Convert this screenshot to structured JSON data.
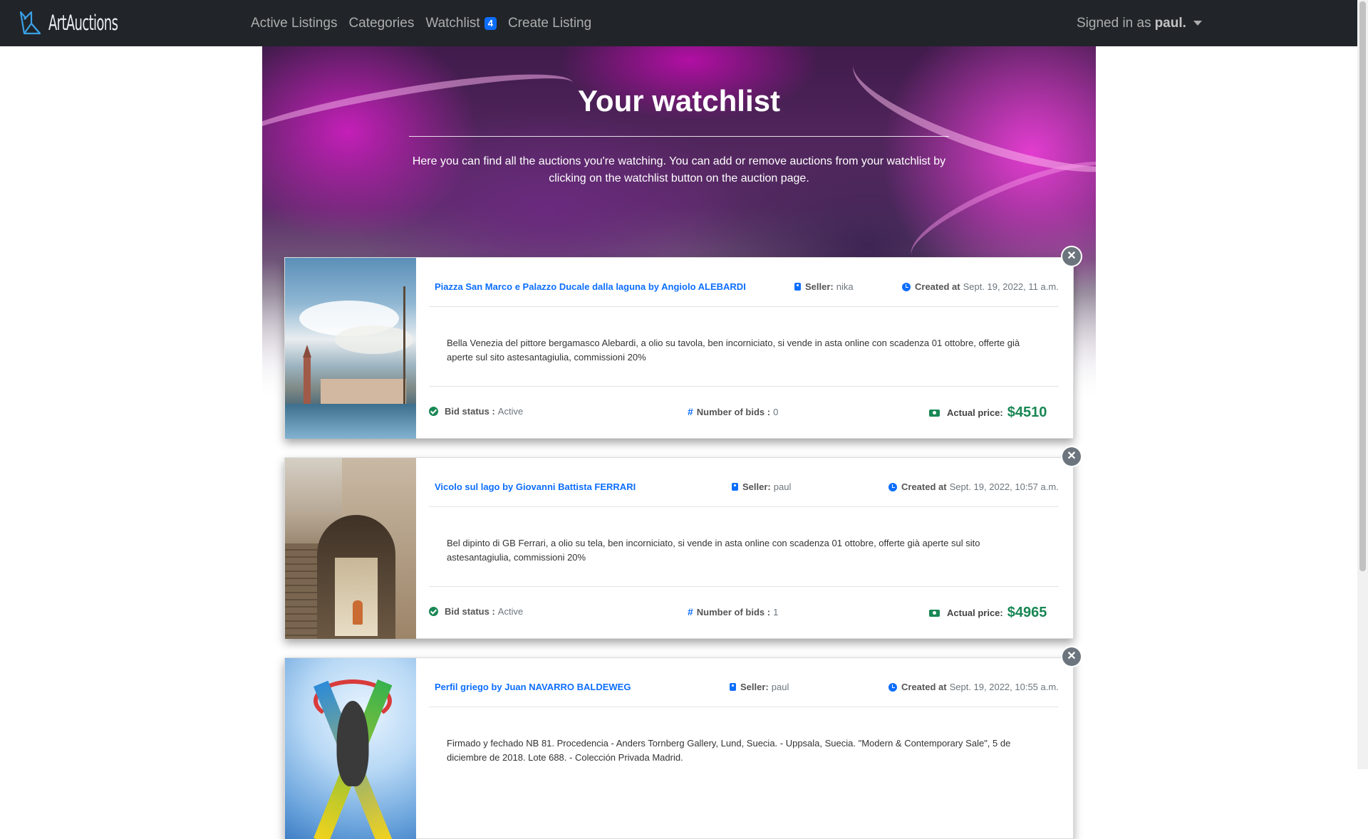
{
  "nav": {
    "brand": "ArtAuctions",
    "links": [
      "Active Listings",
      "Categories",
      "Watchlist",
      "Create Listing"
    ],
    "watchlist_count": "4",
    "signed_prefix": "Signed in as",
    "user": "paul."
  },
  "hero": {
    "title": "Your watchlist",
    "text": "Here you can find all the auctions you're watching. You can add or remove auctions from your watchlist by clicking on the watchlist button on the auction page."
  },
  "labels": {
    "seller": "Seller:",
    "created": "Created at",
    "bid_status": "Bid status :",
    "bids": "Number of bids :",
    "price": "Actual price:",
    "remove": "✕"
  },
  "items": [
    {
      "title": "Piazza San Marco e Palazzo Ducale dalla laguna by Angiolo ALEBARDI",
      "seller": "nika",
      "created": "Sept. 19, 2022, 11 a.m.",
      "description": "Bella Venezia del pittore bergamasco Alebardi, a olio su tavola, ben incorniciato, si vende in asta online con scadenza 01 ottobre, offerte già aperte sul sito astesantagiulia, commissioni 20%",
      "status": "Active",
      "bids": "0",
      "price": "$4510"
    },
    {
      "title": "Vicolo sul lago by Giovanni Battista FERRARI",
      "seller": "paul",
      "created": "Sept. 19, 2022, 10:57 a.m.",
      "description": "Bel dipinto di GB Ferrari, a olio su tela, ben incorniciato, si vende in asta online con scadenza 01 ottobre, offerte già aperte sul sito astesantagiulia, commissioni 20%",
      "status": "Active",
      "bids": "1",
      "price": "$4965"
    },
    {
      "title": "Perfil griego by Juan NAVARRO BALDEWEG",
      "seller": "paul",
      "created": "Sept. 19, 2022, 10:55 a.m.",
      "description": "Firmado y fechado NB 81. Procedencia - Anders Tornberg Gallery, Lund, Suecia. - Uppsala, Suecia. \"Modern & Contemporary Sale\", 5 de diciembre de 2018. Lote 688. - Colección Privada Madrid."
    }
  ]
}
